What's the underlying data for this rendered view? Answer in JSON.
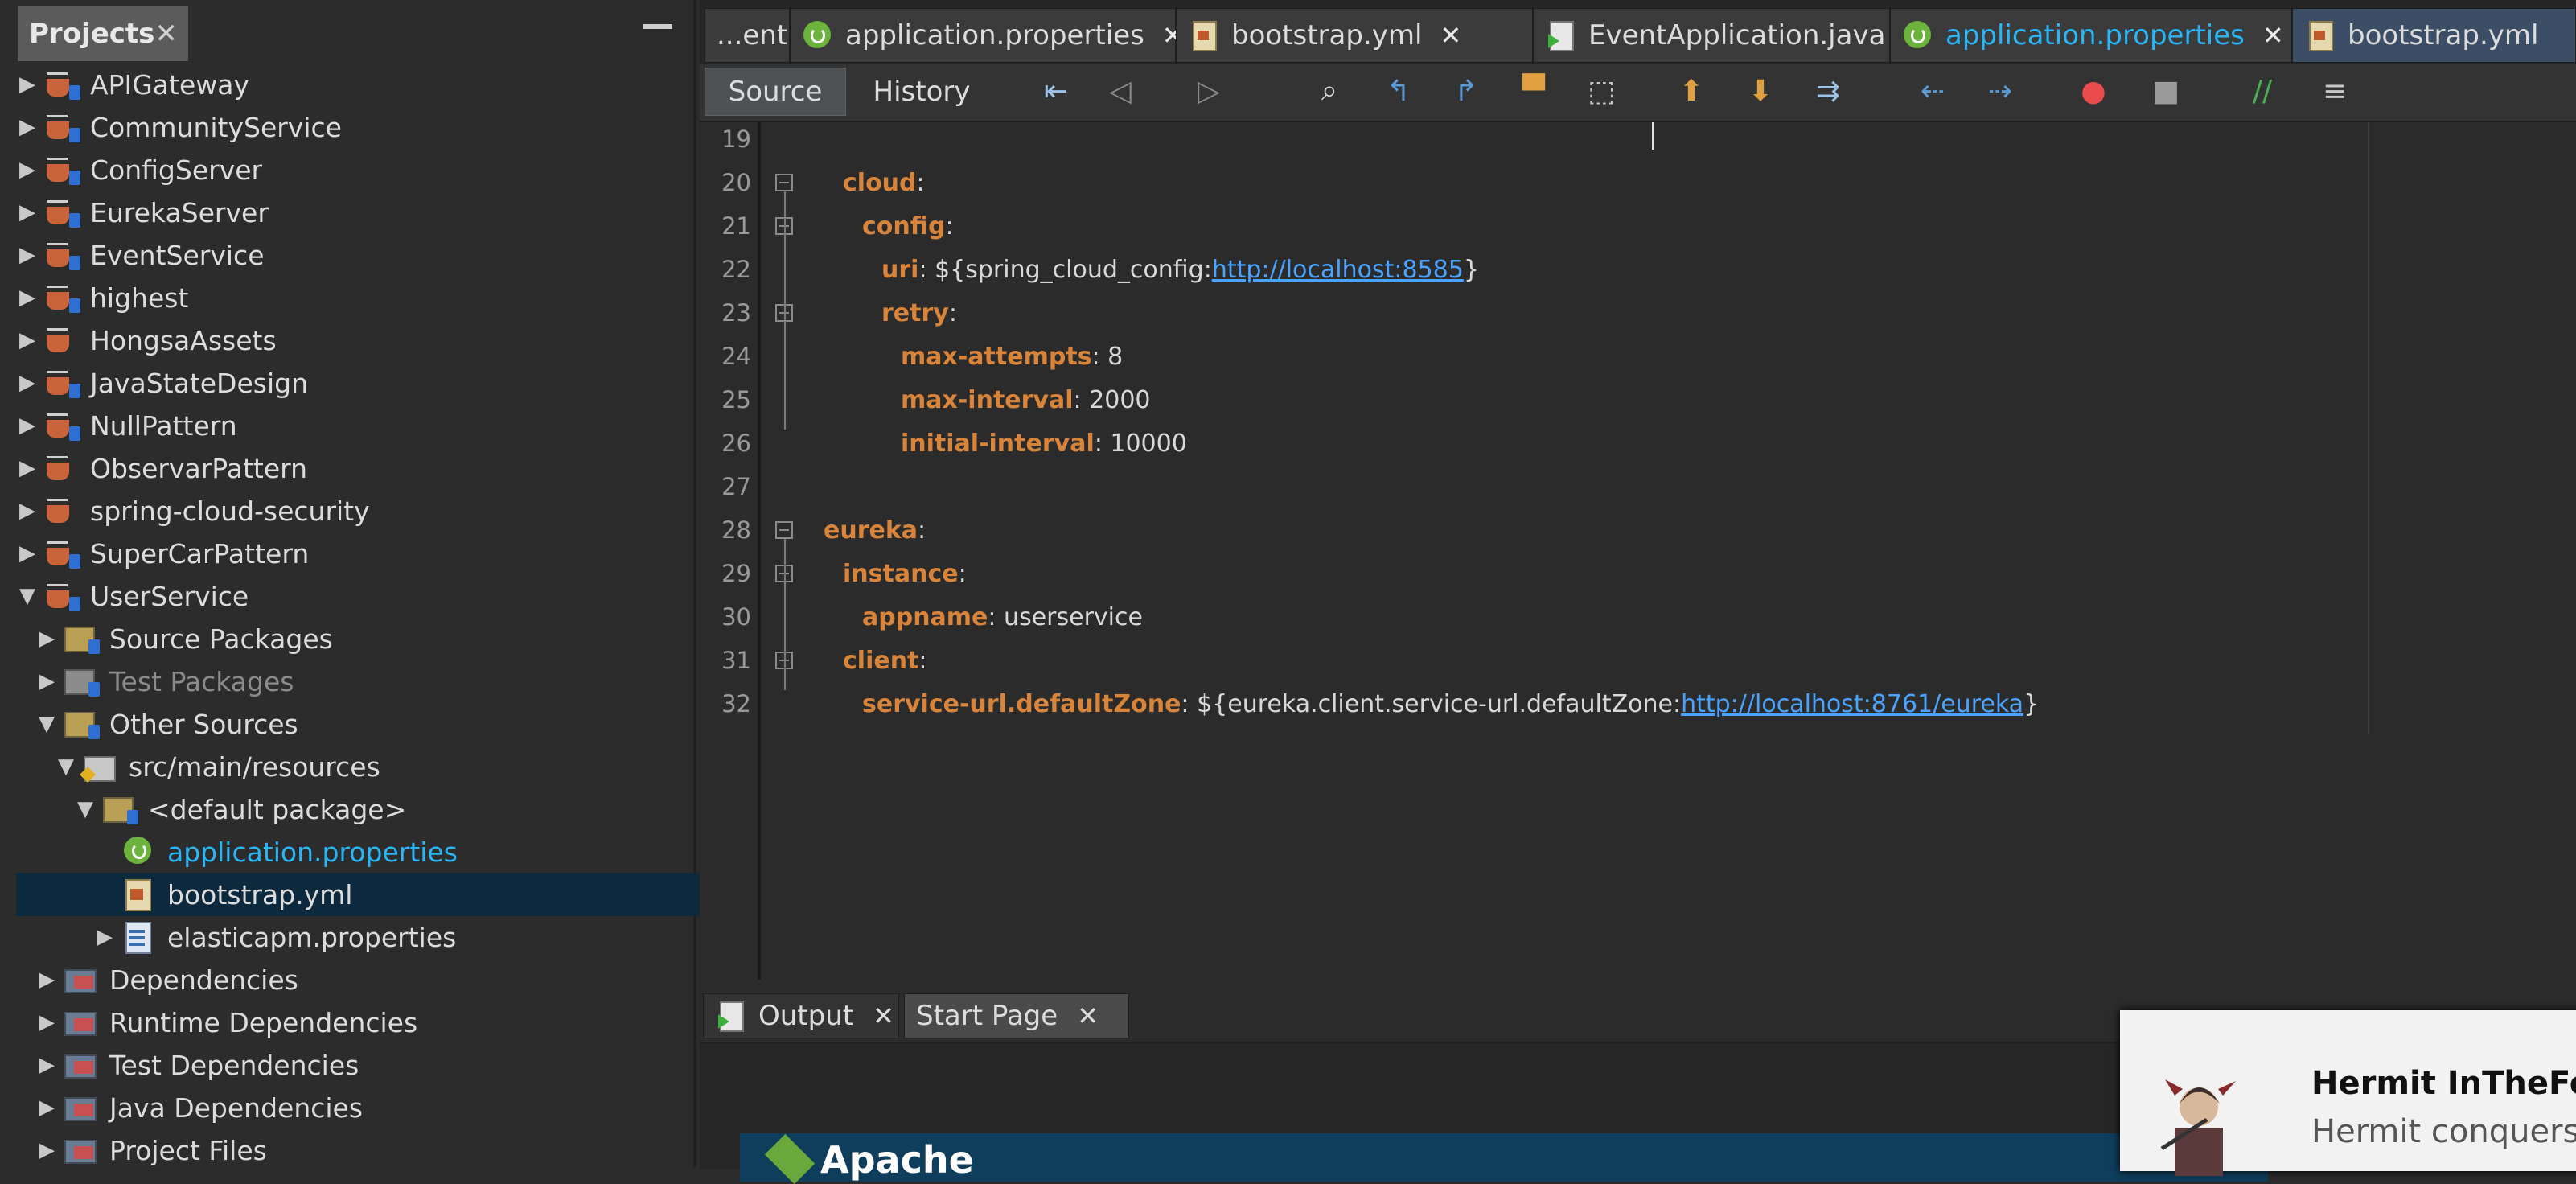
{
  "projects_panel": {
    "title": "Projects",
    "close_glyph": "✕",
    "minimize_glyph": "—",
    "items": [
      {
        "label": "APIGateway",
        "icon": "maven-project-icon",
        "expanded": false
      },
      {
        "label": "CommunityService",
        "icon": "maven-project-icon",
        "expanded": false
      },
      {
        "label": "ConfigServer",
        "icon": "maven-project-icon",
        "expanded": false
      },
      {
        "label": "EurekaServer",
        "icon": "maven-project-icon",
        "expanded": false
      },
      {
        "label": "EventService",
        "icon": "maven-project-icon",
        "expanded": false
      },
      {
        "label": "highest",
        "icon": "maven-project-icon",
        "expanded": false
      },
      {
        "label": "HongsaAssets",
        "icon": "java-project-icon",
        "expanded": false
      },
      {
        "label": "JavaStateDesign",
        "icon": "maven-project-icon",
        "expanded": false
      },
      {
        "label": "NullPattern",
        "icon": "maven-project-icon",
        "expanded": false
      },
      {
        "label": "ObservarPattern",
        "icon": "java-project-icon",
        "expanded": false
      },
      {
        "label": "spring-cloud-security",
        "icon": "java-project-icon",
        "expanded": false
      },
      {
        "label": "SuperCarPattern",
        "icon": "maven-project-icon",
        "expanded": false
      },
      {
        "label": "UserService",
        "icon": "maven-project-icon",
        "expanded": true
      },
      {
        "label": "Source Packages",
        "icon": "package-folder-icon",
        "expanded": false
      },
      {
        "label": "Test Packages",
        "icon": "package-folder-icon",
        "expanded": false
      },
      {
        "label": "Other Sources",
        "icon": "package-folder-icon",
        "expanded": true
      },
      {
        "label": "src/main/resources",
        "icon": "resources-folder-icon",
        "expanded": true
      },
      {
        "label": "<default package>",
        "icon": "package-icon",
        "expanded": true
      },
      {
        "label": "application.properties",
        "icon": "spring-boot-icon"
      },
      {
        "label": "bootstrap.yml",
        "icon": "yml-file-icon"
      },
      {
        "label": "elasticapm.properties",
        "icon": "properties-file-icon",
        "expanded": false
      },
      {
        "label": "Dependencies",
        "icon": "library-icon",
        "expanded": false
      },
      {
        "label": "Runtime Dependencies",
        "icon": "library-icon",
        "expanded": false
      },
      {
        "label": "Test Dependencies",
        "icon": "library-icon",
        "expanded": false
      },
      {
        "label": "Java Dependencies",
        "icon": "library-icon",
        "expanded": false
      },
      {
        "label": "Project Files",
        "icon": "library-icon",
        "expanded": false
      }
    ]
  },
  "editor_tabs": [
    {
      "label": "...ent",
      "icon": "",
      "close": ""
    },
    {
      "label": "application.properties",
      "icon": "spring-boot-icon",
      "close": "✕"
    },
    {
      "label": "bootstrap.yml",
      "icon": "yml-file-icon",
      "close": "✕"
    },
    {
      "label": "EventApplication.java",
      "icon": "java-run-icon",
      "close": "✕"
    },
    {
      "label": "application.properties",
      "icon": "spring-boot-icon",
      "close": "✕"
    },
    {
      "label": "bootstrap.yml",
      "icon": "yml-file-icon",
      "close": ""
    }
  ],
  "toolbar": {
    "source_label": "Source",
    "history_label": "History",
    "icons": [
      {
        "name": "last-edit-icon",
        "glyph": "⇤",
        "color": "#9ec1e6"
      },
      {
        "name": "back-icon",
        "glyph": "◁",
        "color": "#8c8c8c"
      },
      {
        "name": "forward-icon",
        "glyph": "▷",
        "color": "#8c8c8c"
      },
      {
        "name": "find-icon",
        "glyph": "⌕",
        "color": "#d6d6d6"
      },
      {
        "name": "find-previous-icon",
        "glyph": "↰",
        "color": "#5b9bd5"
      },
      {
        "name": "find-next-icon",
        "glyph": "↱",
        "color": "#5b9bd5"
      },
      {
        "name": "toggle-highlight-icon",
        "glyph": "▀",
        "color": "#e0a040"
      },
      {
        "name": "rectangular-selection-icon",
        "glyph": "⬚",
        "color": "#c8c8c8"
      },
      {
        "name": "previous-bookmark-icon",
        "glyph": "⬆",
        "color": "#e0a040"
      },
      {
        "name": "next-bookmark-icon",
        "glyph": "⬇",
        "color": "#e0a040"
      },
      {
        "name": "toggle-bookmark-icon",
        "glyph": "⇉",
        "color": "#9ec1e6"
      },
      {
        "name": "shift-left-icon",
        "glyph": "⇠",
        "color": "#5b9bd5"
      },
      {
        "name": "shift-right-icon",
        "glyph": "⇢",
        "color": "#5b9bd5"
      },
      {
        "name": "start-macro-recording-icon",
        "glyph": "●",
        "color": "#e84c4c"
      },
      {
        "name": "stop-macro-recording-icon",
        "glyph": "■",
        "color": "#9a9a9a"
      },
      {
        "name": "comment-icon",
        "glyph": "//",
        "color": "#4caf50"
      },
      {
        "name": "uncomment-icon",
        "glyph": "≡",
        "color": "#c8c8c8"
      }
    ]
  },
  "editor": {
    "lines": [
      {
        "num": "19",
        "indent": 0,
        "tokens": []
      },
      {
        "num": "20",
        "indent": 1,
        "tokens": [
          {
            "t": "cloud",
            "k": "k"
          },
          {
            "t": ":",
            "k": "p"
          }
        ]
      },
      {
        "num": "21",
        "indent": 2,
        "tokens": [
          {
            "t": "config",
            "k": "k"
          },
          {
            "t": ":",
            "k": "p"
          }
        ]
      },
      {
        "num": "22",
        "indent": 3,
        "tokens": [
          {
            "t": "uri",
            "k": "k"
          },
          {
            "t": ": ${spring_cloud_config:",
            "k": "p"
          },
          {
            "t": "http://localhost:8585",
            "k": "u"
          },
          {
            "t": "}",
            "k": "p"
          }
        ]
      },
      {
        "num": "23",
        "indent": 3,
        "tokens": [
          {
            "t": "retry",
            "k": "k"
          },
          {
            "t": ":",
            "k": "p"
          }
        ]
      },
      {
        "num": "24",
        "indent": 4,
        "tokens": [
          {
            "t": "max-attempts",
            "k": "k"
          },
          {
            "t": ": 8",
            "k": "p"
          }
        ]
      },
      {
        "num": "25",
        "indent": 4,
        "tokens": [
          {
            "t": "max-interval",
            "k": "k"
          },
          {
            "t": ": 2000",
            "k": "p"
          }
        ]
      },
      {
        "num": "26",
        "indent": 4,
        "tokens": [
          {
            "t": "initial-interval",
            "k": "k"
          },
          {
            "t": ": 10000",
            "k": "p"
          }
        ]
      },
      {
        "num": "27",
        "indent": 0,
        "tokens": []
      },
      {
        "num": "28",
        "indent": 0,
        "tokens": [
          {
            "t": "eureka",
            "k": "k"
          },
          {
            "t": ":",
            "k": "p"
          }
        ]
      },
      {
        "num": "29",
        "indent": 1,
        "tokens": [
          {
            "t": "instance",
            "k": "k"
          },
          {
            "t": ":",
            "k": "p"
          }
        ]
      },
      {
        "num": "30",
        "indent": 2,
        "tokens": [
          {
            "t": "appname",
            "k": "k"
          },
          {
            "t": ": userservice",
            "k": "p"
          }
        ]
      },
      {
        "num": "31",
        "indent": 1,
        "tokens": [
          {
            "t": "client",
            "k": "k"
          },
          {
            "t": ":",
            "k": "p"
          }
        ]
      },
      {
        "num": "32",
        "indent": 2,
        "tokens": [
          {
            "t": "service-url.defaultZone",
            "k": "k"
          },
          {
            "t": ": ${eureka.client.service-url.defaultZone:",
            "k": "p"
          },
          {
            "t": "http://localhost:8761/eureka",
            "k": "u"
          },
          {
            "t": "}",
            "k": "p"
          }
        ]
      }
    ]
  },
  "output_panel": {
    "tabs": [
      {
        "label": "Output",
        "close": "✕"
      },
      {
        "label": "Start Page",
        "close": "✕"
      }
    ],
    "start_page_heading": "Apache"
  },
  "notification": {
    "title": "Hermit InTheFor",
    "subtitle": "Hermit conquers"
  },
  "colors": {
    "keyword": "#d9843b",
    "link": "#4aa3ff",
    "active_tab": "#3c4e66",
    "selected_row": "#0d293e",
    "highlight_text": "#29b6f6"
  }
}
